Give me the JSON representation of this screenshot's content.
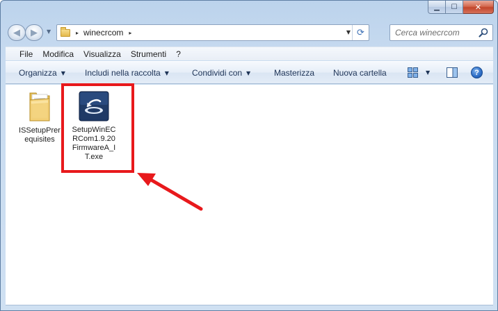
{
  "window": {
    "caption_buttons": {
      "minimize": "▁",
      "maximize": "☐",
      "close": "✕"
    }
  },
  "navigation": {
    "back_icon": "◀",
    "forward_icon": "▶",
    "history_dropdown": "▼",
    "breadcrumb": [
      "winecrcom"
    ],
    "breadcrumb_arrow": "▸",
    "address_dropdown": "▼",
    "refresh_icon": "⟳",
    "search_placeholder": "Cerca winecrcom"
  },
  "menubar": {
    "items": [
      "File",
      "Modifica",
      "Visualizza",
      "Strumenti",
      "?"
    ]
  },
  "commandbar": {
    "organizza": "Organizza",
    "includi": "Includi nella raccolta",
    "condividi": "Condividi con",
    "masterizza": "Masterizza",
    "nuova_cartella": "Nuova cartella",
    "caret": "▼",
    "help": "?"
  },
  "files": [
    {
      "name": "ISSetupPrerequisites",
      "type": "folder",
      "icon": "folder-icon"
    },
    {
      "name": "SetupWinECRCom1.9.20FirmwareA_IT.exe",
      "type": "exe",
      "icon": "installer-icon"
    }
  ],
  "colors": {
    "highlight_box": "#e8191c",
    "arrow": "#e8191c"
  }
}
